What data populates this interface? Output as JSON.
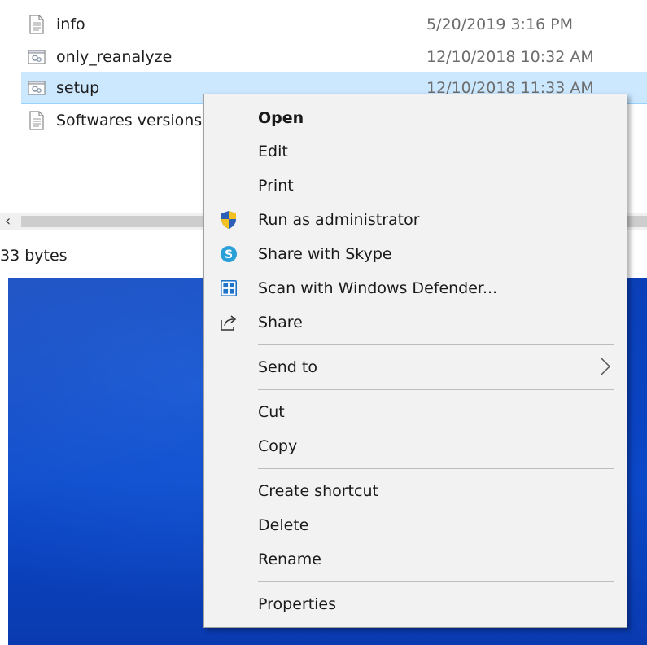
{
  "files": [
    {
      "name": "info",
      "date": "5/20/2019 3:16 PM",
      "icon": "text-file-icon"
    },
    {
      "name": "only_reanalyze",
      "date": "12/10/2018 10:32 AM",
      "icon": "settings-file-icon"
    },
    {
      "name": "setup",
      "date": "12/10/2018 11:33 AM",
      "icon": "settings-file-icon",
      "selected": true
    },
    {
      "name": "Softwares versions",
      "date": "",
      "icon": "text-file-icon"
    }
  ],
  "status": {
    "text": "33 bytes"
  },
  "context_menu": {
    "items": {
      "open": "Open",
      "edit": "Edit",
      "print": "Print",
      "run_as_admin": "Run as administrator",
      "share_skype": "Share with Skype",
      "scan_defender": "Scan with Windows Defender...",
      "share": "Share",
      "send_to": "Send to",
      "cut": "Cut",
      "copy": "Copy",
      "create_shortcut": "Create shortcut",
      "delete": "Delete",
      "rename": "Rename",
      "properties": "Properties"
    },
    "icons": {
      "run_as_admin": "uac-shield-icon",
      "share_skype": "skype-icon",
      "scan_defender": "windows-defender-icon",
      "share": "share-icon",
      "send_to": "chevron-right-icon"
    }
  },
  "colors": {
    "selection_bg": "#cce8ff",
    "menu_bg": "#f2f2f2",
    "desktop_blue": "#0a42c0"
  }
}
